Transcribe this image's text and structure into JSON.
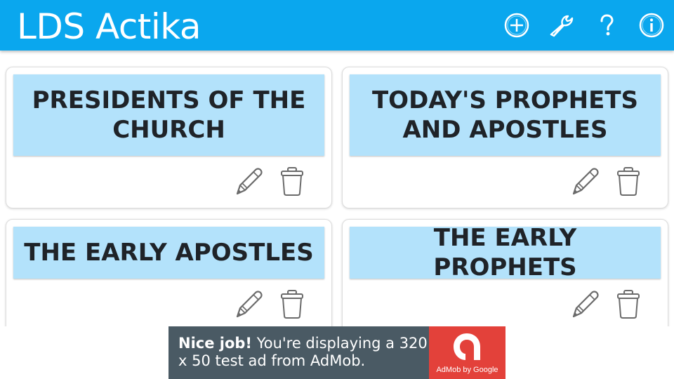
{
  "app_bar": {
    "title": "LDS Actika",
    "background": "#0aa7ee",
    "actions": [
      {
        "name": "add",
        "icon": "plus-circle-icon"
      },
      {
        "name": "settings",
        "icon": "wrench-icon"
      },
      {
        "name": "help",
        "icon": "question-mark-icon"
      },
      {
        "name": "info",
        "icon": "info-circle-icon"
      }
    ]
  },
  "decks": [
    {
      "title": "PRESIDENTS OF THE CHURCH",
      "edit_icon": "pencil-icon",
      "delete_icon": "trash-icon"
    },
    {
      "title": "TODAY'S PROPHETS AND APOSTLES",
      "edit_icon": "pencil-icon",
      "delete_icon": "trash-icon"
    },
    {
      "title": "THE EARLY APOSTLES",
      "edit_icon": "pencil-icon",
      "delete_icon": "trash-icon"
    },
    {
      "title": "THE EARLY PROPHETS",
      "edit_icon": "pencil-icon",
      "delete_icon": "trash-icon"
    }
  ],
  "ad": {
    "headline": "Nice job!",
    "body": " You're displaying a 320 x 50 test ad from AdMob.",
    "brand": "AdMob by Google",
    "background": "#4a5a64",
    "logo_color": "#e3413a"
  },
  "colors": {
    "card_title_bg": "#b3e2fb",
    "icon_gray": "#6b6b6b"
  }
}
